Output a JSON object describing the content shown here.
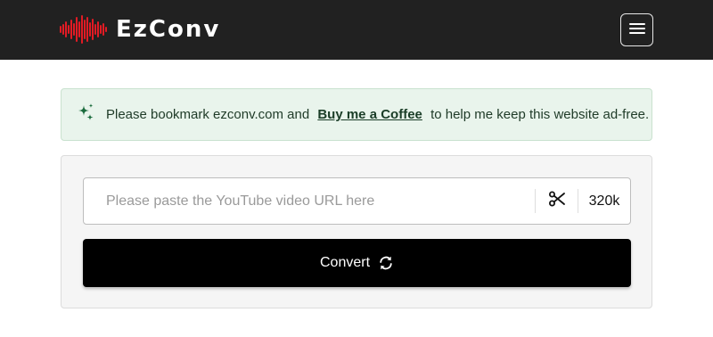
{
  "header": {
    "brand_name": "EzConv",
    "logo_icon": "soundwave-icon",
    "menu_icon": "hamburger-menu-icon"
  },
  "notice": {
    "icon": "sparkles-icon",
    "text_before": "Please bookmark ezconv.com and",
    "link_text": "Buy me a Coffee",
    "text_after": "to help me keep this website ad-free."
  },
  "converter": {
    "url_placeholder": "Please paste the YouTube video URL here",
    "url_value": "",
    "trim_icon": "scissors-icon",
    "quality": "320k",
    "convert_label": "Convert",
    "convert_icon": "refresh-icon"
  },
  "colors": {
    "navbar_bg": "#212121",
    "logo_accent": "#e21b24",
    "notice_bg": "#e9f4ec",
    "notice_accent": "#1a6b3c",
    "button_bg": "#000000"
  }
}
